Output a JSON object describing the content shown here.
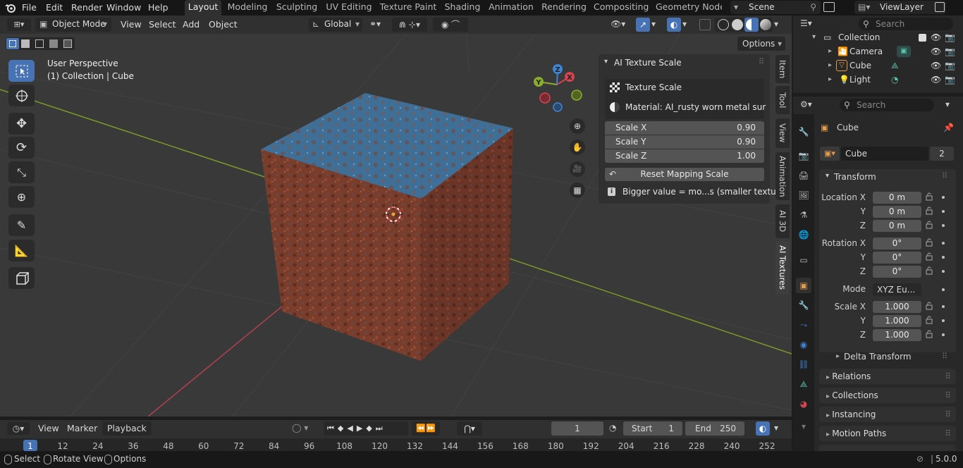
{
  "topbar": {
    "menus": [
      "File",
      "Edit",
      "Render",
      "Window",
      "Help"
    ],
    "workspaces": [
      "Layout",
      "Modeling",
      "Sculpting",
      "UV Editing",
      "Texture Paint",
      "Shading",
      "Animation",
      "Rendering",
      "Compositing",
      "Geometry Nodes"
    ],
    "scene": "Scene",
    "view_layer": "ViewLayer"
  },
  "viewport_header": {
    "mode": "Object Mode",
    "menus": [
      "View",
      "Select",
      "Add",
      "Object"
    ],
    "orientation": "Global",
    "options_label": "Options"
  },
  "viewport": {
    "perspective_label": "User Perspective",
    "collection_label": "(1) Collection | Cube",
    "gizmo_axes": [
      "X",
      "Y",
      "Z"
    ]
  },
  "n_panel": {
    "title": "AI Texture Scale",
    "texture_scale_label": "Texture Scale",
    "material_label": "Material: AI_rusty worn metal sur",
    "rows": [
      {
        "label": "Scale X",
        "value": "0.90"
      },
      {
        "label": "Scale Y",
        "value": "0.90"
      },
      {
        "label": "Scale Z",
        "value": "1.00"
      }
    ],
    "reset_label": "Reset Mapping Scale",
    "hint": "Bigger value = mo...s (smaller texture)"
  },
  "side_tabs": [
    "Item",
    "Tool",
    "View",
    "Animation",
    "AI 3D",
    "AI Textures"
  ],
  "timeline": {
    "menus": [
      "View",
      "Marker"
    ],
    "playback": "Playback",
    "current_frame": "1",
    "start_label": "Start",
    "start_value": "1",
    "end_label": "End",
    "end_value": "250",
    "ticks": [
      "1",
      "12",
      "24",
      "36",
      "48",
      "60",
      "72",
      "84",
      "96",
      "108",
      "120",
      "132",
      "144",
      "156",
      "168",
      "180",
      "192",
      "204",
      "216",
      "228",
      "240",
      "252"
    ]
  },
  "statusbar": {
    "select": "Select",
    "rotate": "Rotate View",
    "options": "Options",
    "version": "5.0.0"
  },
  "outliner": {
    "search_placeholder": "Search",
    "collection": "Collection",
    "items": [
      "Camera",
      "Cube",
      "Light"
    ]
  },
  "properties": {
    "search_placeholder": "Search",
    "object_name": "Cube",
    "data_name": "Cube",
    "users": "2",
    "transform_title": "Transform",
    "location_label": "Location X",
    "location": [
      "0 m",
      "0 m",
      "0 m"
    ],
    "rotation_label": "Rotation X",
    "rotation": [
      "0°",
      "0°",
      "0°"
    ],
    "mode_label": "Mode",
    "mode_value": "XYZ Eu...",
    "scale_label": "Scale X",
    "scale": [
      "1.000",
      "1.000",
      "1.000"
    ],
    "axis_y": "Y",
    "axis_z": "Z",
    "delta_transform": "Delta Transform",
    "panels": [
      "Relations",
      "Collections",
      "Instancing",
      "Motion Paths"
    ]
  },
  "colors": {
    "accent": "#4772b3",
    "axis_x": "#d44450",
    "axis_y": "#8aad2c",
    "axis_z": "#3f85d6"
  }
}
